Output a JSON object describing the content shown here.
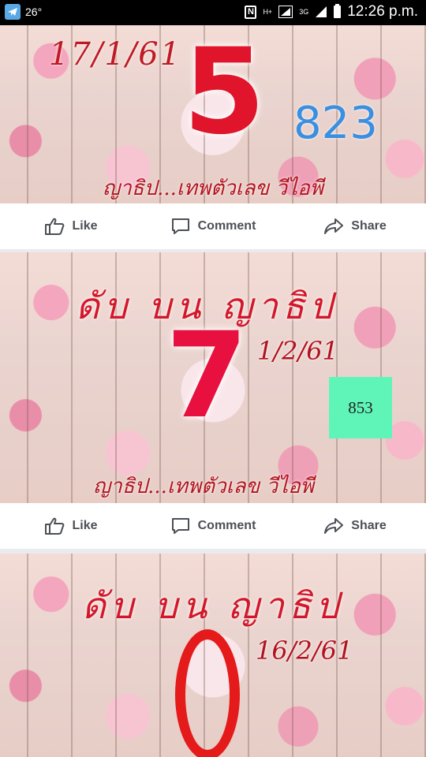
{
  "status_bar": {
    "temperature": "26°",
    "nfc": "N",
    "network_h": "H+",
    "network_3g": "3G",
    "time": "12:26 p.m."
  },
  "posts": [
    {
      "date": "17/1/61",
      "big_number": "5",
      "side_number": "823",
      "signature": "ญาธิป...เทพตัวเลข วีไอพี"
    },
    {
      "heading": "ดับ บน ญาธิป",
      "date": "1/2/61",
      "big_number": "7",
      "box_number": "853",
      "signature": "ญาธิป...เทพตัวเลข วีไอพี"
    },
    {
      "heading": "ดับ บน ญาธิป",
      "date": "16/2/61",
      "big_number": "0"
    }
  ],
  "actions": {
    "like": "Like",
    "comment": "Comment",
    "share": "Share"
  }
}
